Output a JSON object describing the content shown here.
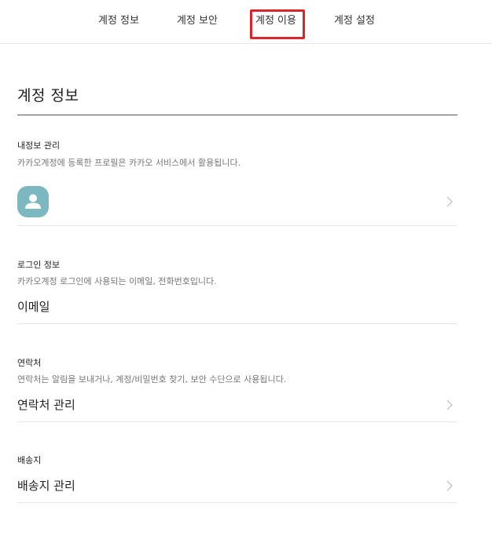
{
  "nav": {
    "tabs": [
      {
        "label": "계정 정보"
      },
      {
        "label": "계정 보안"
      },
      {
        "label": "계정 이용"
      },
      {
        "label": "계정 설정"
      }
    ],
    "highlight_color": "#d9252b"
  },
  "page": {
    "title": "계정 정보"
  },
  "sections": {
    "profile": {
      "title": "내정보 관리",
      "description": "카카오계정에 등록한 프로필은 카카오 서비스에서 활용됩니다.",
      "avatar_icon": "user-silhouette-icon",
      "avatar_color": "#7bb8bf"
    },
    "login": {
      "title": "로그인 정보",
      "description": "카카오계정 로그인에 사용되는 이메일, 전화번호입니다.",
      "value": "이메일"
    },
    "contact": {
      "title": "연락처",
      "description": "연락처는 알림을 보내거나, 계정/비밀번호 찾기, 보안 수단으로 사용됩니다.",
      "value": "연락처 관리"
    },
    "shipping": {
      "title": "배송지",
      "value": "배송지 관리"
    }
  }
}
